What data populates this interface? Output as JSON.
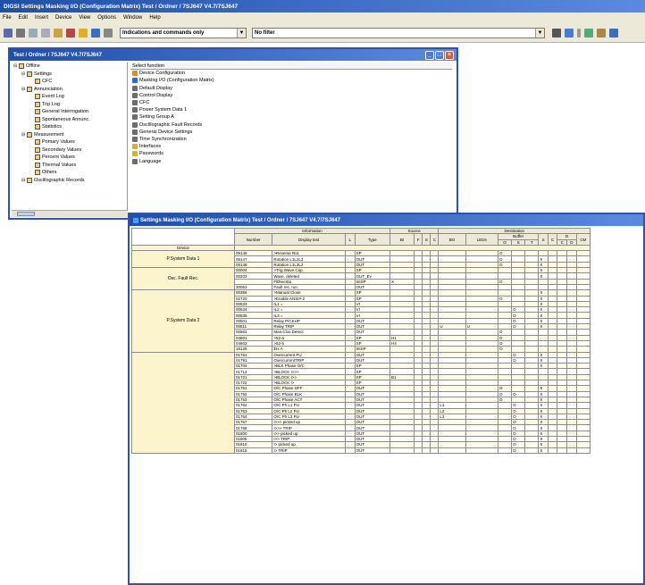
{
  "app": {
    "title": "DIGSI Settings Masking I/O (Configuration Matrix) Test / Ordner / 7SJ647 V4.7/7SJ647",
    "menus": [
      "File",
      "Edit",
      "Insert",
      "Device",
      "View",
      "Options",
      "Window",
      "Help"
    ],
    "filter_combo": "Indications and commands only",
    "filter_combo2": "No filter"
  },
  "tree_window": {
    "title": "Test / Ordner / 7SJ647 V4.7/7SJ647",
    "tree": [
      {
        "label": "Offline",
        "indent": 0
      },
      {
        "label": "Settings",
        "indent": 1
      },
      {
        "label": "CFC",
        "indent": 2
      },
      {
        "label": "Annunciation",
        "indent": 1
      },
      {
        "label": "Event Log",
        "indent": 2
      },
      {
        "label": "Trip Log",
        "indent": 2
      },
      {
        "label": "General Interrogation",
        "indent": 2
      },
      {
        "label": "Spontaneous Annunc.",
        "indent": 2
      },
      {
        "label": "Statistics",
        "indent": 2
      },
      {
        "label": "Measurement",
        "indent": 1
      },
      {
        "label": "Primary Values",
        "indent": 2
      },
      {
        "label": "Secondary Values",
        "indent": 2
      },
      {
        "label": "Percent Values",
        "indent": 2
      },
      {
        "label": "Thermal Values",
        "indent": 2
      },
      {
        "label": "Others",
        "indent": 2
      },
      {
        "label": "Oscillographic Records",
        "indent": 1
      }
    ],
    "list_header": "Select function",
    "list": [
      {
        "label": "Device Configuration",
        "color": "#e08a2a"
      },
      {
        "label": "Masking I/O (Configuration Matrix)",
        "color": "#2a6ae0"
      },
      {
        "label": "Default Display",
        "color": "#6d6d6d"
      },
      {
        "label": "Control Display",
        "color": "#6d6d6d"
      },
      {
        "label": "CFC",
        "color": "#6d6d6d"
      },
      {
        "label": "Power System Data 1",
        "color": "#6d6d6d"
      },
      {
        "label": "Setting Group A",
        "color": "#6d6d6d"
      },
      {
        "label": "Oscillographic Fault Records",
        "color": "#6d6d6d"
      },
      {
        "label": "General Device Settings",
        "color": "#6d6d6d"
      },
      {
        "label": "Time Synchronization",
        "color": "#6d6d6d"
      },
      {
        "label": "Interfaces",
        "color": "#d8b030"
      },
      {
        "label": "Passwords",
        "color": "#d8b030"
      },
      {
        "label": "Language",
        "color": "#6d6d6d"
      }
    ]
  },
  "matrix_window": {
    "title": "Settings Masking I/O (Configuration Matrix) Test / Ordner / 7SJ647 V4.7/7SJ647",
    "header": {
      "information": "Information",
      "source": "Source",
      "destination": "Destination",
      "number": "Number",
      "display_text": "Display text",
      "long": "L",
      "type": "Type",
      "bi": "BI",
      "f": "F",
      "s": "S",
      "c": "C",
      "bo": "BO",
      "leds": "LEDs",
      "buffer": "Buffer",
      "buffer_o": "O",
      "buffer_s": "S",
      "buffer_t": "T",
      "dest_s": "S",
      "dest_c": "C",
      "display": "D",
      "display_c": "C",
      "display_d": "D",
      "cm": "CM",
      "device": "Device"
    },
    "groups": [
      {
        "label": "P.System Data 1",
        "rows": [
          {
            "num": "05145",
            "text": ">Reverse Rot.",
            "type": "SP",
            "bi": "",
            "bo": "",
            "led": "",
            "o": "O",
            "s": "",
            "x": ""
          },
          {
            "num": "05147",
            "text": "Rotation L1L2L3",
            "type": "OUT",
            "bi": "",
            "bo": "",
            "led": "",
            "o": "O",
            "s": "",
            "x": "X"
          },
          {
            "num": "05148",
            "text": "Rotation L1L3L2",
            "type": "OUT",
            "bi": "",
            "bo": "",
            "led": "",
            "o": "O",
            "s": "",
            "x": "X"
          }
        ]
      },
      {
        "label": "Osc. Fault Rec.",
        "rows": [
          {
            "num": "00004",
            "text": ">Trig.Wave.Cap.",
            "type": "SP",
            "bi": "",
            "bo": "",
            "led": "",
            "o": "",
            "s": "",
            "x": "X"
          },
          {
            "num": "00203",
            "text": "Wave. deleted",
            "type": "OUT_Ev",
            "bi": "",
            "bo": "",
            "led": "",
            "o": "",
            "s": "",
            "x": "X"
          },
          {
            "num": "",
            "text": "FltRecSta",
            "type": "IntSP",
            "bi": "X",
            "bo": "",
            "led": "",
            "o": "O",
            "s": "",
            "x": ""
          },
          {
            "num": "30053",
            "text": "Fault rec. run.",
            "type": "OUT",
            "bi": "",
            "bo": "",
            "led": "",
            "o": "",
            "s": "",
            "x": ""
          }
        ]
      },
      {
        "label": "P.System Data 2",
        "rows": [
          {
            "num": "00356",
            "text": ">Manual Close",
            "type": "SP",
            "bi": "",
            "bo": "",
            "led": "",
            "o": "",
            "s": "",
            "x": "X"
          },
          {
            "num": "02720",
            "text": ">Enable ANSI#-2",
            "type": "SP",
            "bi": "",
            "bo": "",
            "led": "",
            "o": "O",
            "s": "",
            "x": "X"
          },
          {
            "num": "00533",
            "text": "IL1 =",
            "type": "VI",
            "bi": "",
            "bo": "",
            "led": "",
            "o": "",
            "s": "",
            "x": "X"
          },
          {
            "num": "00534",
            "text": "IL2 =",
            "type": "VI",
            "bi": "",
            "bo": "",
            "led": "",
            "o": "",
            "s": "O",
            "x": "X"
          },
          {
            "num": "00535",
            "text": "IL3 =",
            "type": "VI",
            "bi": "",
            "bo": "",
            "led": "",
            "o": "",
            "s": "O",
            "x": "X"
          },
          {
            "num": "00501",
            "text": "Relay PICKUP",
            "type": "OUT",
            "bi": "",
            "bo": "",
            "led": "",
            "o": "",
            "s": "O",
            "x": "X"
          },
          {
            "num": "00511",
            "text": "Relay TRIP",
            "type": "OUT",
            "bi": "",
            "bo": "U",
            "led": "U",
            "o": "",
            "s": "O",
            "x": "X"
          },
          {
            "num": "00561",
            "text": "Man.Clos.Detect",
            "type": "OUT",
            "bi": "",
            "bo": "",
            "led": "",
            "o": "O",
            "s": "",
            "x": ""
          },
          {
            "num": "04601",
            "text": ">52-a",
            "type": "SP",
            "bi": "H1",
            "bo": "",
            "led": "",
            "o": "O",
            "s": "",
            "x": ""
          },
          {
            "num": "04602",
            "text": ">52-b",
            "type": "SP",
            "bi": "H4",
            "bo": "",
            "led": "",
            "o": "O",
            "s": "",
            "x": ""
          },
          {
            "num": "16126",
            "text": "ΣIx A",
            "type": "IntSP",
            "bi": "",
            "bo": "",
            "led": "",
            "o": "O",
            "s": "",
            "x": ""
          }
        ]
      },
      {
        "label": "",
        "rows": [
          {
            "num": "01761",
            "text": "Overcurrent PU",
            "type": "OUT",
            "bi": "",
            "bo": "",
            "led": "",
            "o": "",
            "s": "O",
            "x": "X"
          },
          {
            "num": "01791",
            "text": "OvercurrentTRIP",
            "type": "OUT",
            "bi": "",
            "bo": "",
            "led": "",
            "o": "",
            "s": "O",
            "x": "X"
          },
          {
            "num": "01704",
            "text": ">BLK Phase O/C",
            "type": "SP",
            "bi": "",
            "bo": "",
            "led": "",
            "o": "",
            "s": "",
            "x": "X"
          },
          {
            "num": "01714",
            "text": ">BLOCK I>>>",
            "type": "SP",
            "bi": "",
            "bo": "",
            "led": "",
            "o": "",
            "s": "",
            "x": ""
          },
          {
            "num": "01721",
            "text": ">BLOCK I>>",
            "type": "SP",
            "bi": "B1",
            "bo": "",
            "led": "",
            "o": "",
            "s": "",
            "x": ""
          },
          {
            "num": "01722",
            "text": ">BLOCK I>",
            "type": "SP",
            "bi": "",
            "bo": "",
            "led": "",
            "o": "",
            "s": "",
            "x": ""
          },
          {
            "num": "01751",
            "text": "O/C Phase OFF",
            "type": "OUT",
            "bi": "",
            "bo": "",
            "led": "",
            "o": "O",
            "s": "",
            "x": "X"
          },
          {
            "num": "01752",
            "text": "O/C Phase BLK",
            "type": "OUT",
            "bi": "",
            "bo": "",
            "led": "",
            "o": "O",
            "s": "O",
            "x": "X"
          },
          {
            "num": "01753",
            "text": "O/C Phase ACT",
            "type": "OUT",
            "bi": "",
            "bo": "",
            "led": "",
            "o": "O",
            "s": "",
            "x": "X"
          },
          {
            "num": "01762",
            "text": "O/C Ph L1 PU",
            "type": "OUT",
            "bi": "",
            "bo": "L1",
            "led": "",
            "o": "",
            "s": "O",
            "x": "X"
          },
          {
            "num": "01763",
            "text": "O/C Ph L2 PU",
            "type": "OUT",
            "bi": "",
            "bo": "L2",
            "led": "",
            "o": "",
            "s": "O",
            "x": "X"
          },
          {
            "num": "01764",
            "text": "O/C Ph L3 PU",
            "type": "OUT",
            "bi": "",
            "bo": "L3",
            "led": "",
            "o": "",
            "s": "O",
            "x": "X"
          },
          {
            "num": "01767",
            "text": "I>>> picked up",
            "type": "OUT",
            "bi": "",
            "bo": "",
            "led": "",
            "o": "",
            "s": "O",
            "x": "X"
          },
          {
            "num": "01768",
            "text": "I>>> TRIP",
            "type": "OUT",
            "bi": "",
            "bo": "",
            "led": "",
            "o": "",
            "s": "O",
            "x": "X"
          },
          {
            "num": "01800",
            "text": "I>> picked up",
            "type": "OUT",
            "bi": "",
            "bo": "",
            "led": "",
            "o": "",
            "s": "O",
            "x": "X"
          },
          {
            "num": "01805",
            "text": "I>> TRIP",
            "type": "OUT",
            "bi": "",
            "bo": "",
            "led": "",
            "o": "",
            "s": "O",
            "x": "X"
          },
          {
            "num": "01810",
            "text": "I> picked up",
            "type": "OUT",
            "bi": "",
            "bo": "",
            "led": "",
            "o": "",
            "s": "O",
            "x": "X"
          },
          {
            "num": "01815",
            "text": "I> TRIP",
            "type": "OUT",
            "bi": "",
            "bo": "",
            "led": "",
            "o": "",
            "s": "O",
            "x": "X"
          }
        ]
      }
    ]
  }
}
